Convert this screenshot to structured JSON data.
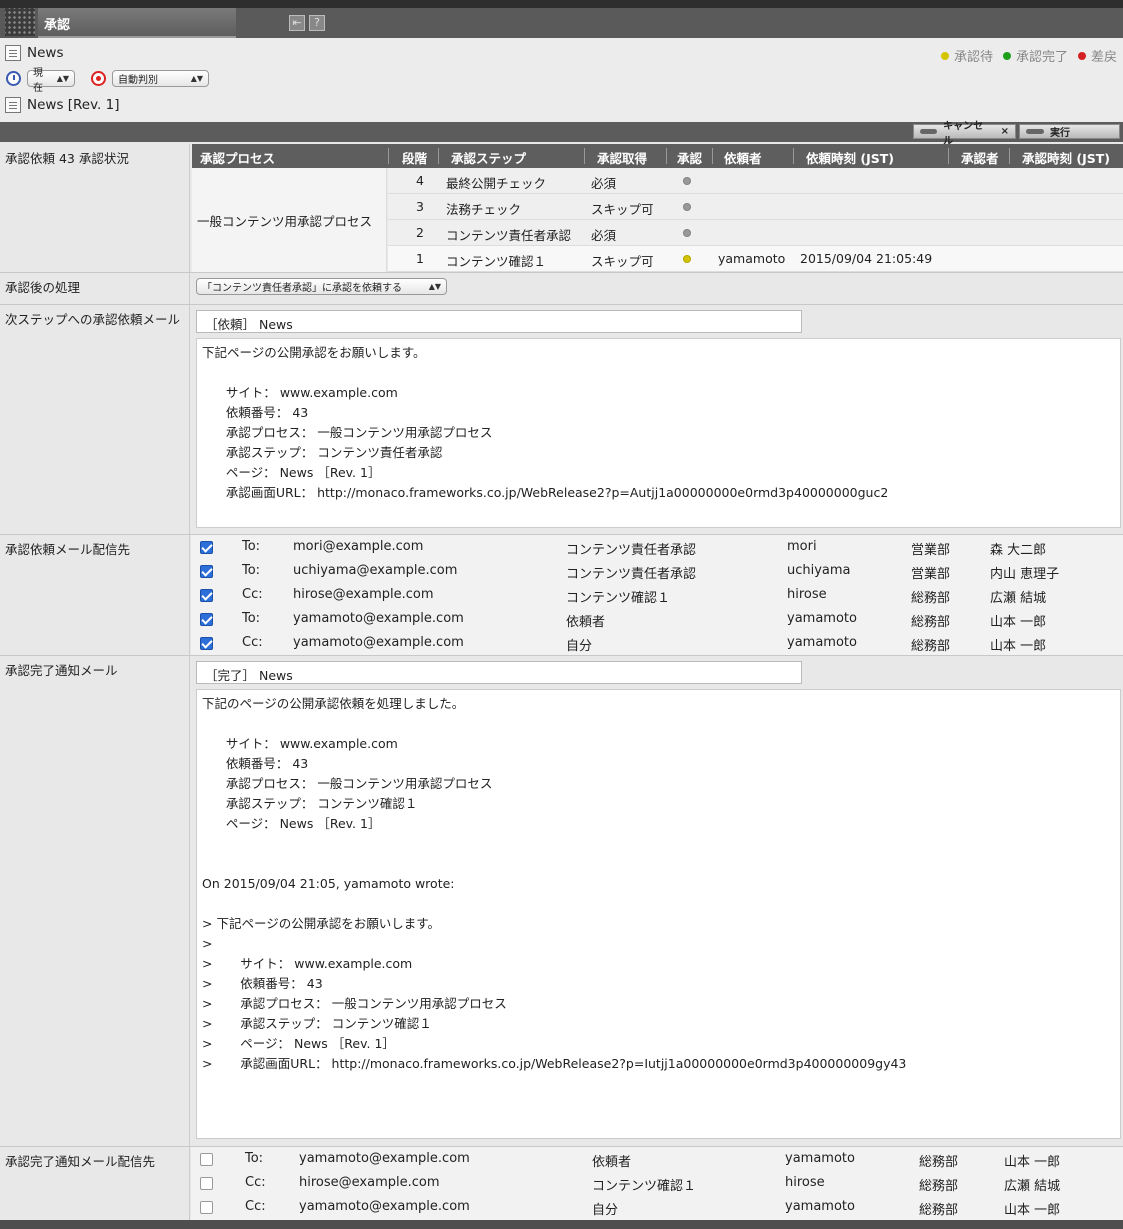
{
  "window": {
    "title": "承認"
  },
  "header": {
    "page_name": "News",
    "time_select": "現在",
    "judge_select": "自動判別",
    "page_rev": "News [Rev. 1]",
    "legend": [
      {
        "label": "承認待",
        "color": "#d4c400"
      },
      {
        "label": "承認完了",
        "color": "#1ca01c"
      },
      {
        "label": "差戻",
        "color": "#d42020"
      }
    ]
  },
  "actions": {
    "cancel": "キャンセル",
    "cancel_x": "×",
    "execute": "実行"
  },
  "status": {
    "label": "承認依頼 43 承認状況",
    "columns": [
      "承認プロセス",
      "段階",
      "承認ステップ",
      "承認取得",
      "承認",
      "依頼者",
      "依頼時刻 (JST)",
      "承認者",
      "承認時刻 (JST)"
    ],
    "process": "一般コンテンツ用承認プロセス",
    "rows": [
      {
        "stage": "4",
        "step": "最終公開チェック",
        "acquire": "必須",
        "dot": "#999999",
        "requester": "",
        "time": ""
      },
      {
        "stage": "3",
        "step": "法務チェック",
        "acquire": "スキップ可",
        "dot": "#999999",
        "requester": "",
        "time": ""
      },
      {
        "stage": "2",
        "step": "コンテンツ責任者承認",
        "acquire": "必須",
        "dot": "#999999",
        "requester": "",
        "time": ""
      },
      {
        "stage": "1",
        "step": "コンテンツ確認１",
        "acquire": "スキップ可",
        "dot": "#d4c400",
        "requester": "yamamoto",
        "time": "2015/09/04 21:05:49"
      }
    ]
  },
  "after": {
    "label": "承認後の処理",
    "select": "「コンテンツ責任者承認」に承認を依頼する"
  },
  "next_mail": {
    "label": "次ステップへの承認依頼メール",
    "subject": "［依頼］ News",
    "body": "下記ページの公開承認をお願いします。\n\n      サイト： www.example.com\n      依頼番号： 43\n      承認プロセス： 一般コンテンツ用承認プロセス\n      承認ステップ： コンテンツ責任者承認\n      ページ： News ［Rev. 1］\n      承認画面URL： http://monaco.frameworks.co.jp/WebRelease2?p=Autjj1a00000000e0rmd3p40000000guc2"
  },
  "next_recipients": {
    "label": "承認依頼メール配信先",
    "rows": [
      {
        "type": "To:",
        "email": "mori@example.com",
        "role": "コンテンツ責任者承認",
        "user": "mori",
        "dept": "営業部",
        "name": "森 大二郎",
        "checked": true
      },
      {
        "type": "To:",
        "email": "uchiyama@example.com",
        "role": "コンテンツ責任者承認",
        "user": "uchiyama",
        "dept": "営業部",
        "name": "内山 恵理子",
        "checked": true
      },
      {
        "type": "Cc:",
        "email": "hirose@example.com",
        "role": "コンテンツ確認１",
        "user": "hirose",
        "dept": "総務部",
        "name": "広瀬 結城",
        "checked": true
      },
      {
        "type": "To:",
        "email": "yamamoto@example.com",
        "role": "依頼者",
        "user": "yamamoto",
        "dept": "総務部",
        "name": "山本 一郎",
        "checked": true
      },
      {
        "type": "Cc:",
        "email": "yamamoto@example.com",
        "role": "自分",
        "user": "yamamoto",
        "dept": "総務部",
        "name": "山本 一郎",
        "checked": true
      }
    ]
  },
  "done_mail": {
    "label": "承認完了通知メール",
    "subject": "［完了］ News",
    "body": "下記のページの公開承認依頼を処理しました。\n\n      サイト： www.example.com\n      依頼番号： 43\n      承認プロセス： 一般コンテンツ用承認プロセス\n      承認ステップ： コンテンツ確認１\n      ページ： News ［Rev. 1］\n\n\nOn 2015/09/04 21:05, yamamoto wrote:\n\n> 下記ページの公開承認をお願いします。\n>\n>       サイト： www.example.com\n>       依頼番号： 43\n>       承認プロセス： 一般コンテンツ用承認プロセス\n>       承認ステップ： コンテンツ確認１\n>       ページ： News ［Rev. 1］\n>       承認画面URL： http://monaco.frameworks.co.jp/WebRelease2?p=Iutjj1a00000000e0rmd3p400000009gy43"
  },
  "done_recipients": {
    "label": "承認完了通知メール配信先",
    "rows": [
      {
        "type": "To:",
        "email": "yamamoto@example.com",
        "role": "依頼者",
        "user": "yamamoto",
        "dept": "総務部",
        "name": "山本 一郎",
        "checked": false
      },
      {
        "type": "Cc:",
        "email": "hirose@example.com",
        "role": "コンテンツ確認１",
        "user": "hirose",
        "dept": "総務部",
        "name": "広瀬 結城",
        "checked": false
      },
      {
        "type": "Cc:",
        "email": "yamamoto@example.com",
        "role": "自分",
        "user": "yamamoto",
        "dept": "総務部",
        "name": "山本 一郎",
        "checked": false
      }
    ]
  }
}
